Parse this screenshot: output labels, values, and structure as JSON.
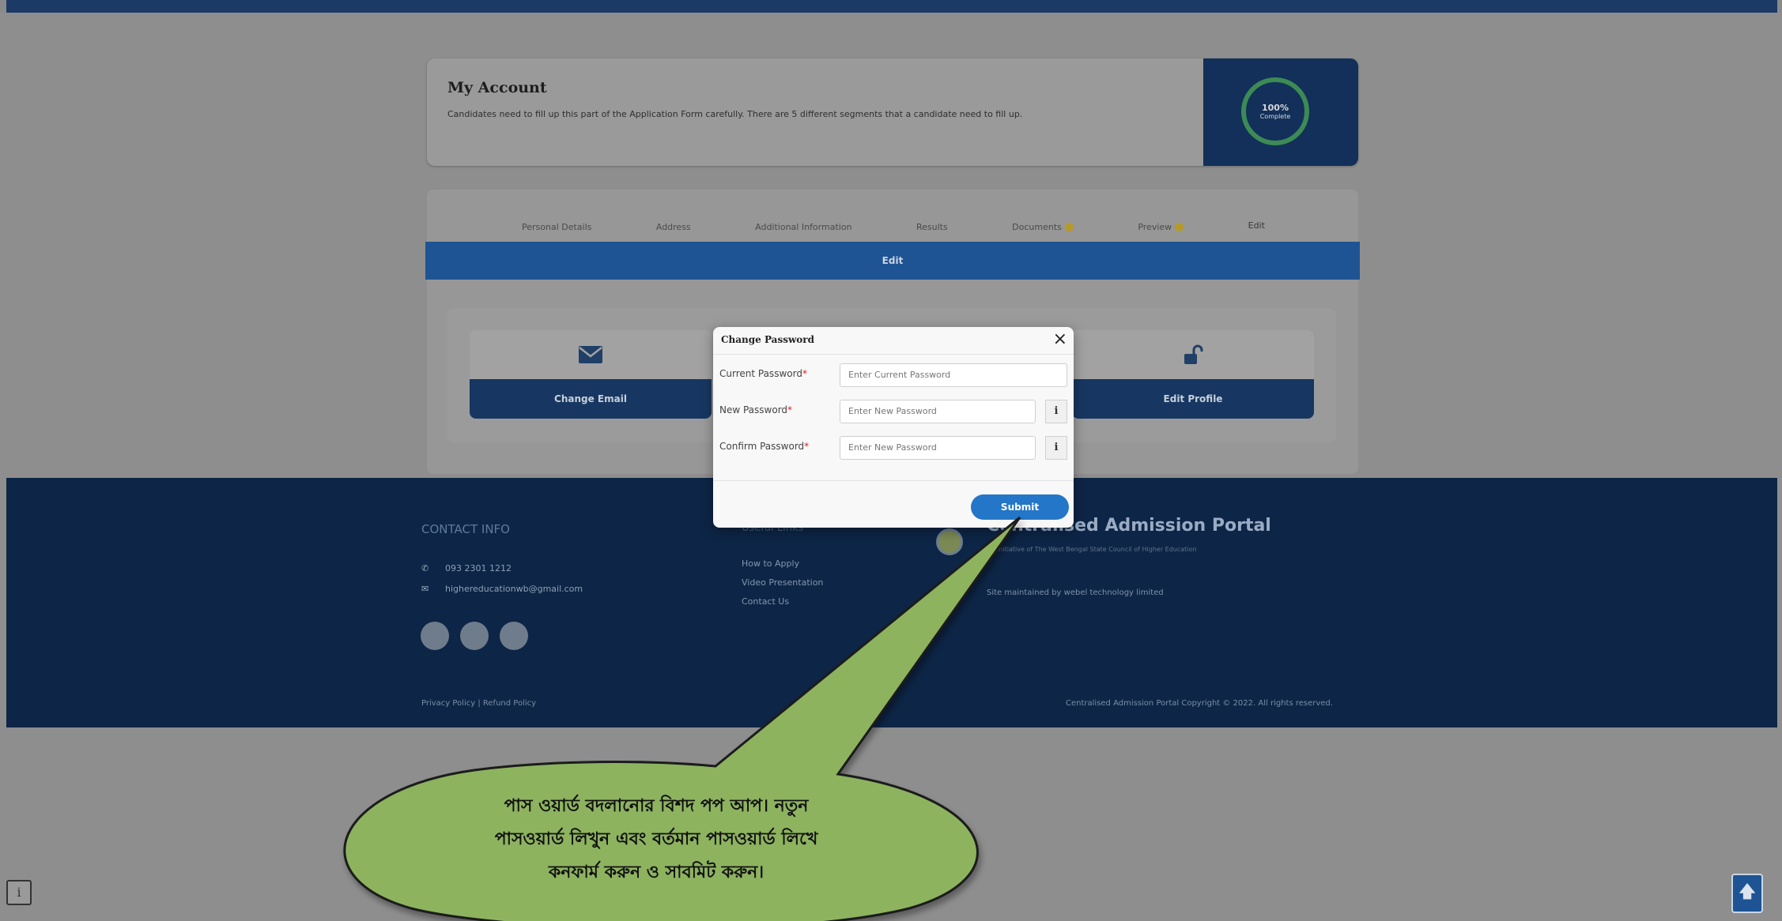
{
  "account": {
    "title": "My Account",
    "description": "Candidates need to fill up this part of the Application Form carefully. There are 5 different segments that a candidate need to fill up.",
    "progress_percent": 100,
    "progress_text": "100%",
    "progress_label": "Complete"
  },
  "tabs": [
    {
      "label": "Personal Details",
      "warning": false,
      "active": false
    },
    {
      "label": "Address",
      "warning": false,
      "active": false
    },
    {
      "label": "Additional Information",
      "warning": false,
      "active": false
    },
    {
      "label": "Results",
      "warning": false,
      "active": false
    },
    {
      "label": "Documents",
      "warning": true,
      "active": false
    },
    {
      "label": "Preview",
      "warning": true,
      "active": false
    },
    {
      "label": "Edit",
      "warning": false,
      "active": true
    }
  ],
  "edit_bar": {
    "title": "Edit"
  },
  "edit_tiles": [
    {
      "label": "Change Email",
      "icon": "envelope-icon"
    },
    {
      "label": "Edit Profile",
      "icon": "unlock-icon"
    }
  ],
  "modal": {
    "title": "Change Password",
    "close_symbol": "×",
    "fields": [
      {
        "label": "Current Password",
        "required": true,
        "placeholder": "Enter Current Password",
        "has_info": false
      },
      {
        "label": "New Password",
        "required": true,
        "placeholder": "Enter New Password",
        "has_info": true
      },
      {
        "label": "Confirm Password",
        "required": true,
        "placeholder": "Enter New Password",
        "has_info": true
      }
    ],
    "info_symbol": "i",
    "submit_label": "Submit"
  },
  "footer": {
    "contact_heading": "CONTACT INFO",
    "phone": "093 2301 1212",
    "email": "highereducationwb@gmail.com",
    "links_heading": "Useful Links",
    "links": [
      "How to Apply",
      "Video Presentation",
      "Contact Us"
    ],
    "brand": "Centralised Admission Portal",
    "brand_sub": "An initiative of The West Bengal State Council of Higher Education",
    "maintained": "Site maintained by webel technology limited",
    "privacy": "Privacy Policy",
    "refund": "Refund Policy",
    "copyright": "Centralised Admission Portal Copyright © 2022. All rights reserved."
  },
  "callout": {
    "line1": "পাস ওয়ার্ড বদলানোর বিশদ পপ আপ। নতুন",
    "line2": "পাসওয়ার্ড লিখুন এবং বর্তমান পাসওয়ার্ড লিখে",
    "line3": "কনফার্ম করুন ও সাবমিট করুন।"
  },
  "colors": {
    "navy": "#0d2546",
    "edit_blue": "#1e5494",
    "submit_blue": "#2476c8",
    "callout_green": "#8db35f"
  },
  "widgets": {
    "help_icon": "help-icon",
    "back_to_top_icon": "arrow-up-icon",
    "help_symbol": "i",
    "back_to_top_symbol": "🡅"
  }
}
